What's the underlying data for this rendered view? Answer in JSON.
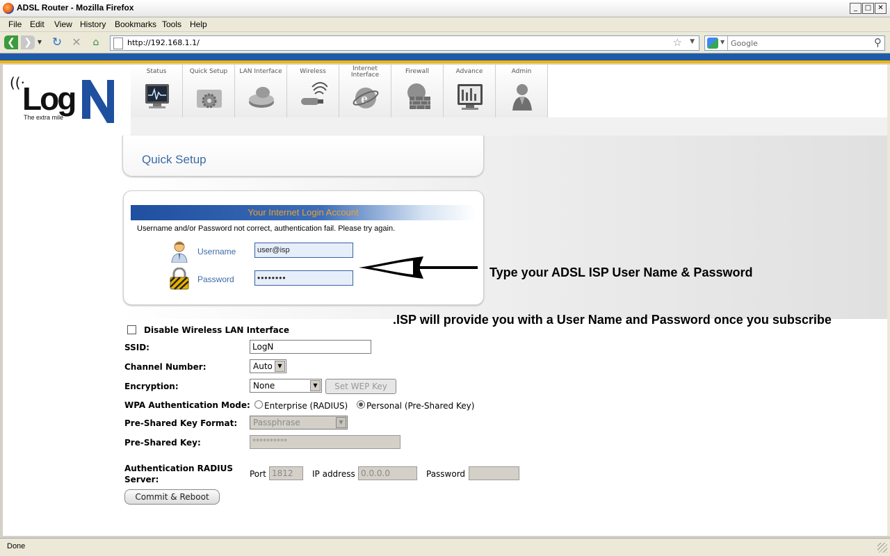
{
  "window": {
    "title": "ADSL Router - Mozilla Firefox",
    "controls": [
      "_",
      "□",
      "✕"
    ]
  },
  "menu": [
    "File",
    "Edit",
    "View",
    "History",
    "Bookmarks",
    "Tools",
    "Help"
  ],
  "toolbar": {
    "url": "http://192.168.1.1/",
    "search_placeholder": "Google"
  },
  "logo": {
    "brand": "Log",
    "tagline": "The extra mile"
  },
  "tabs": [
    {
      "label": "Status",
      "icon": "monitor-icon"
    },
    {
      "label": "Quick Setup",
      "icon": "gears-icon"
    },
    {
      "label": "LAN Interface",
      "icon": "lan-icon"
    },
    {
      "label": "Wireless",
      "icon": "wireless-icon"
    },
    {
      "label": "Internet Interface",
      "icon": "internet-icon"
    },
    {
      "label": "Firewall",
      "icon": "firewall-icon"
    },
    {
      "label": "Advance",
      "icon": "advance-icon"
    },
    {
      "label": "Admin",
      "icon": "admin-icon"
    }
  ],
  "quick_setup": {
    "title": "Quick Setup"
  },
  "login": {
    "header": "Your Internet Login Account",
    "error": "Username and/or Password not correct, authentication fail. Please try again.",
    "username_label": "Username",
    "username_value": "user@isp",
    "password_label": "Password",
    "password_value": "••••••••"
  },
  "annotations": {
    "line1": "Type your ADSL ISP User Name & Password",
    "line2": ".ISP will provide you with a User Name and Password once you subscribe"
  },
  "wireless": {
    "disable_label": "Disable Wireless LAN Interface",
    "ssid_label": "SSID:",
    "ssid_value": "LogN",
    "channel_label": "Channel Number:",
    "channel_value": "Auto",
    "encryption_label": "Encryption:",
    "encryption_value": "None",
    "set_wep_label": "Set WEP Key",
    "wpa_mode_label": "WPA Authentication Mode:",
    "wpa_enterprise": "Enterprise (RADIUS)",
    "wpa_personal": "Personal (Pre-Shared Key)",
    "psk_format_label": "Pre-Shared Key Format:",
    "psk_format_value": "Passphrase",
    "psk_label": "Pre-Shared Key:",
    "psk_value": "**********",
    "radius_label_1": "Authentication RADIUS",
    "radius_label_2": "Server:",
    "port_label": "Port",
    "port_value": "1812",
    "ip_label": "IP address",
    "ip_value": "0.0.0.0",
    "radius_password_label": "Password",
    "radius_password_value": "",
    "commit_label": "Commit & Reboot"
  },
  "status": {
    "text": "Done"
  },
  "colors": {
    "accent_blue": "#3b6aa5",
    "header_gold": "#f0a030",
    "strip_blue": "#1f5aa8",
    "strip_gold": "#f2b400"
  }
}
